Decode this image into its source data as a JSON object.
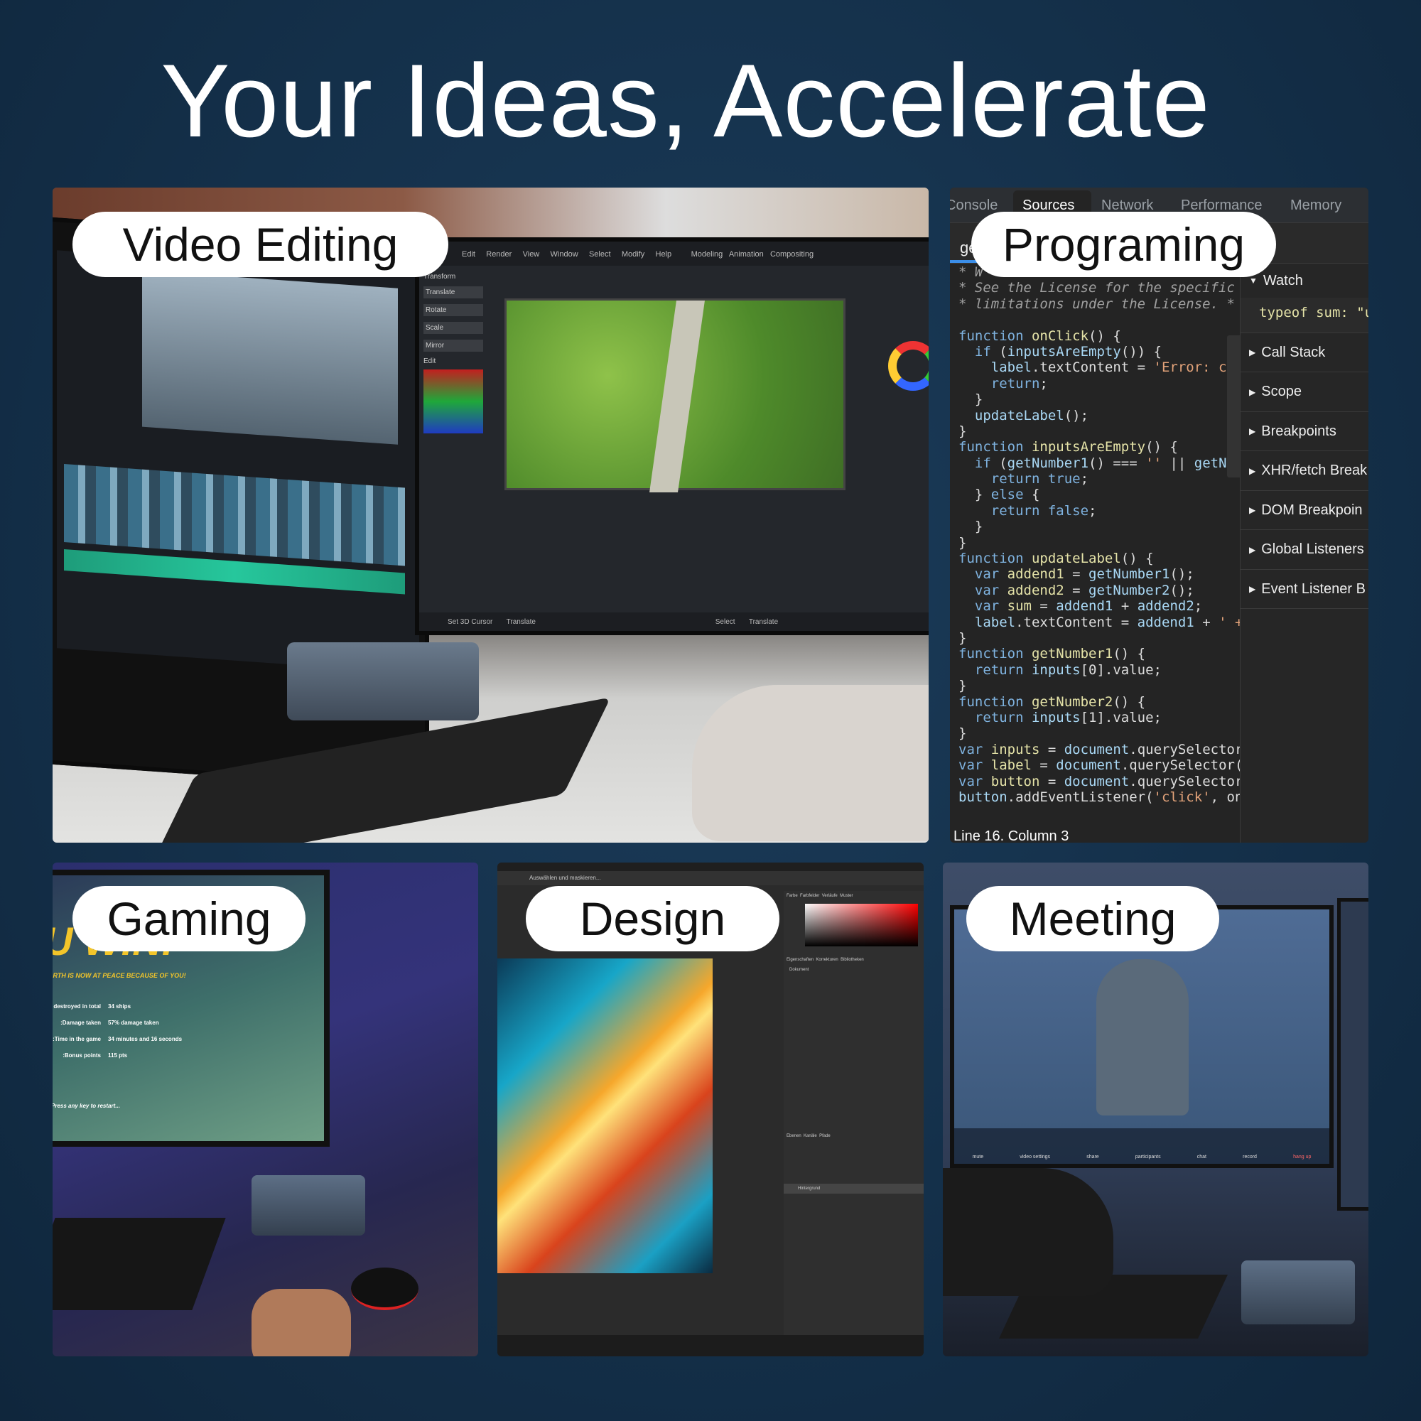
{
  "title": "Your Ideas, Accelerate",
  "panels": {
    "video": {
      "label": "Video Editing",
      "menu": [
        "Edit",
        "Render",
        "View",
        "Window",
        "Select",
        "Modify",
        "Help"
      ],
      "modes": [
        "Modeling",
        "Animation",
        "Compositing"
      ],
      "tools": [
        "Transform",
        "Translate",
        "Rotate",
        "Scale",
        "Mirror",
        "Edit"
      ],
      "footer": [
        "Set 3D Cursor",
        "Translate",
        "Select",
        "Translate"
      ]
    },
    "programming": {
      "label": "Programing",
      "tabs": [
        "Console",
        "Sources",
        "Network",
        "Performance",
        "Memory"
      ],
      "active_tab": "Sources",
      "file_tab": "ge",
      "code": [
        [
          [
            "* W",
            "cm"
          ]
        ],
        [
          [
            "* See the License for the specific",
            "cm"
          ]
        ],
        [
          [
            "* limitations under the License. *",
            "cm"
          ]
        ],
        [],
        [
          [
            "function ",
            "kw"
          ],
          [
            "onClick",
            "fn"
          ],
          [
            "() {",
            "pl"
          ]
        ],
        [
          [
            "  if ",
            "kw"
          ],
          [
            "(",
            "pl"
          ],
          [
            "inputsAreEmpty",
            "id"
          ],
          [
            "()) {",
            "pl"
          ]
        ],
        [
          [
            "    label",
            "id"
          ],
          [
            ".textContent = ",
            "pl"
          ],
          [
            "'Error: c",
            "str"
          ]
        ],
        [
          [
            "    return",
            "kw"
          ],
          [
            ";",
            "pl"
          ]
        ],
        [
          [
            "  }",
            "pl"
          ]
        ],
        [
          [
            "  updateLabel",
            "id"
          ],
          [
            "();",
            "pl"
          ]
        ],
        [
          [
            "}",
            "pl"
          ]
        ],
        [
          [
            "function ",
            "kw"
          ],
          [
            "inputsAreEmpty",
            "fn"
          ],
          [
            "() {",
            "pl"
          ]
        ],
        [
          [
            "  if ",
            "kw"
          ],
          [
            "(",
            "pl"
          ],
          [
            "getNumber1",
            "id"
          ],
          [
            "() === ",
            "pl"
          ],
          [
            "''",
            "str"
          ],
          [
            " || ",
            "pl"
          ],
          [
            "getN",
            "id"
          ]
        ],
        [
          [
            "    return true",
            "kw"
          ],
          [
            ";",
            "pl"
          ]
        ],
        [
          [
            "  } ",
            "pl"
          ],
          [
            "else",
            "kw"
          ],
          [
            " {",
            "pl"
          ]
        ],
        [
          [
            "    return false",
            "kw"
          ],
          [
            ";",
            "pl"
          ]
        ],
        [
          [
            "  }",
            "pl"
          ]
        ],
        [
          [
            "}",
            "pl"
          ]
        ],
        [
          [
            "function ",
            "kw"
          ],
          [
            "updateLabel",
            "fn"
          ],
          [
            "() {",
            "pl"
          ]
        ],
        [
          [
            "  var ",
            "kw"
          ],
          [
            "addend1",
            "fn"
          ],
          [
            " = ",
            "pl"
          ],
          [
            "getNumber1",
            "id"
          ],
          [
            "();",
            "pl"
          ]
        ],
        [
          [
            "  var ",
            "kw"
          ],
          [
            "addend2",
            "fn"
          ],
          [
            " = ",
            "pl"
          ],
          [
            "getNumber2",
            "id"
          ],
          [
            "();",
            "pl"
          ]
        ],
        [
          [
            "  var ",
            "kw"
          ],
          [
            "sum",
            "fn"
          ],
          [
            " = ",
            "pl"
          ],
          [
            "addend1",
            "id"
          ],
          [
            " + ",
            "pl"
          ],
          [
            "addend2",
            "id"
          ],
          [
            ";",
            "pl"
          ]
        ],
        [
          [
            "  label",
            "id"
          ],
          [
            ".textContent = ",
            "pl"
          ],
          [
            "addend1",
            "id"
          ],
          [
            " + ",
            "pl"
          ],
          [
            "' +",
            "str"
          ]
        ],
        [
          [
            "}",
            "pl"
          ]
        ],
        [
          [
            "function ",
            "kw"
          ],
          [
            "getNumber1",
            "fn"
          ],
          [
            "() {",
            "pl"
          ]
        ],
        [
          [
            "  return ",
            "kw"
          ],
          [
            "inputs",
            "id"
          ],
          [
            "[0].value;",
            "pl"
          ]
        ],
        [
          [
            "}",
            "pl"
          ]
        ],
        [
          [
            "function ",
            "kw"
          ],
          [
            "getNumber2",
            "fn"
          ],
          [
            "() {",
            "pl"
          ]
        ],
        [
          [
            "  return ",
            "kw"
          ],
          [
            "inputs",
            "id"
          ],
          [
            "[1].value;",
            "pl"
          ]
        ],
        [
          [
            "}",
            "pl"
          ]
        ],
        [
          [
            "var ",
            "kw"
          ],
          [
            "inputs",
            "fn"
          ],
          [
            " = ",
            "pl"
          ],
          [
            "document",
            "id"
          ],
          [
            ".querySelector",
            "pl"
          ]
        ],
        [
          [
            "var ",
            "kw"
          ],
          [
            "label",
            "fn"
          ],
          [
            " = ",
            "pl"
          ],
          [
            "document",
            "id"
          ],
          [
            ".querySelector(",
            "pl"
          ]
        ],
        [
          [
            "var ",
            "kw"
          ],
          [
            "button",
            "fn"
          ],
          [
            " = ",
            "pl"
          ],
          [
            "document",
            "id"
          ],
          [
            ".querySelector",
            "pl"
          ]
        ],
        [
          [
            "button",
            "id"
          ],
          [
            ".addEventListener(",
            "pl"
          ],
          [
            "'click'",
            "str"
          ],
          [
            ", on",
            "pl"
          ]
        ]
      ],
      "watch": {
        "label": "Watch",
        "value": "typeof sum: \"u"
      },
      "sections": [
        "Call Stack",
        "Scope",
        "Breakpoints",
        "XHR/fetch Break",
        "DOM Breakpoin",
        "Global Listeners",
        "Event Listener B"
      ],
      "status": "Line 16. Column 3",
      "colors": {
        "keyword": "#7fb3e0",
        "function": "#e5e3a8",
        "identifier": "#a9d8f5",
        "string": "#e3a37a"
      }
    },
    "gaming": {
      "label": "Gaming",
      "banner": "U WIN!",
      "subtitle": "EARTH IS NOW AT PEACE BECAUSE OF YOU!",
      "stats": [
        [
          "Ships destroyed in total:",
          "34 ships"
        ],
        [
          "Damage taken:",
          "57% damage taken"
        ],
        [
          "Time in the game:",
          "34 minutes and 16 seconds"
        ],
        [
          "Bonus points:",
          "115 pts"
        ]
      ],
      "restart": "Press any key to restart..."
    },
    "design": {
      "label": "Design",
      "menu_hint": "Auswählen und maskieren...",
      "panel_tabs": [
        "Farbe",
        "Farbfelder",
        "Verläufe",
        "Muster"
      ],
      "props_tabs": [
        "Eigenschaften",
        "Korrekturen",
        "Bibliotheken"
      ],
      "layers_tabs": [
        "Ebenen",
        "Kanäle",
        "Pfade"
      ],
      "layer": "Hintergrund",
      "doc": "Dokument"
    },
    "meeting": {
      "label": "Meeting",
      "controls": [
        "mute",
        "video settings",
        "share",
        "participants",
        "chat",
        "record",
        "hang up"
      ]
    }
  }
}
